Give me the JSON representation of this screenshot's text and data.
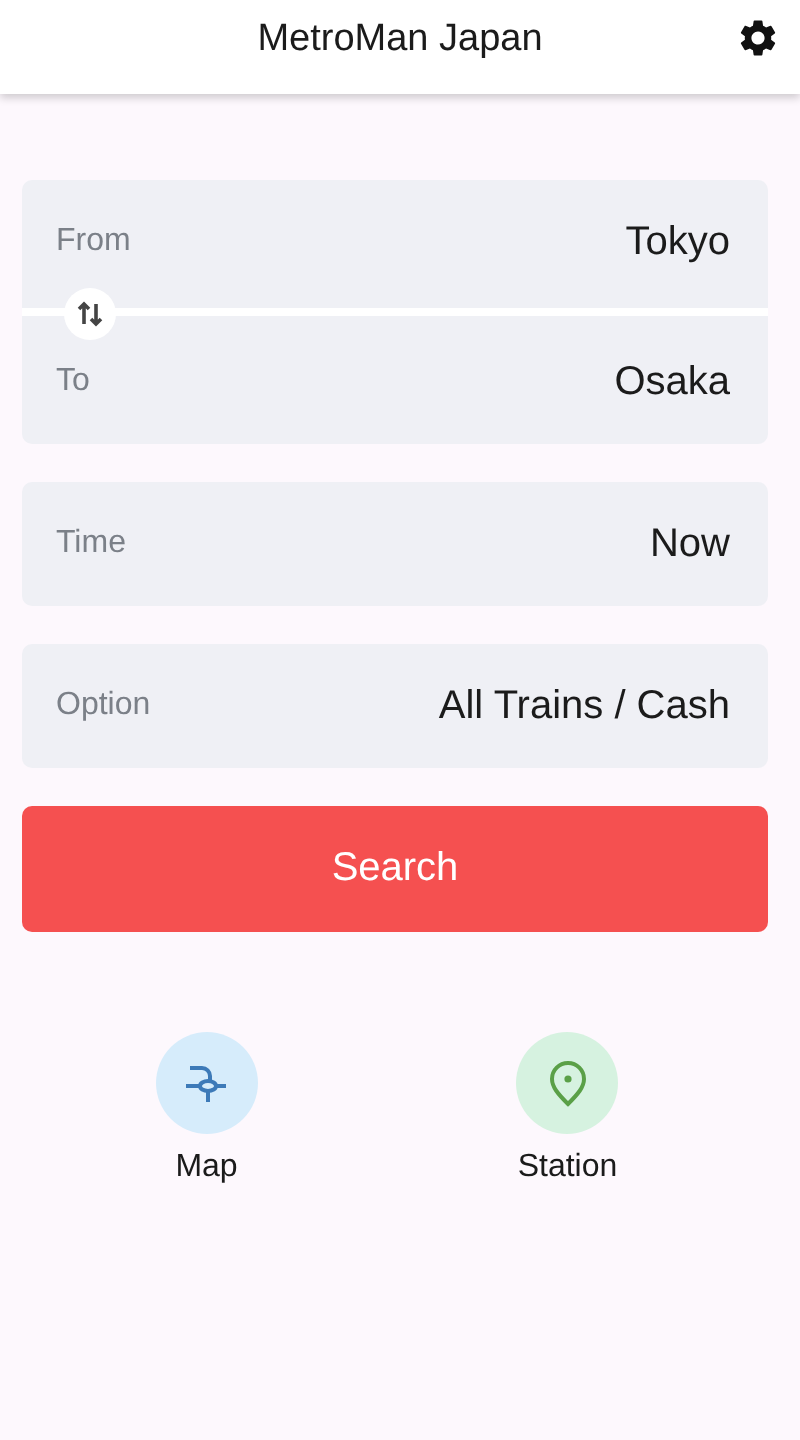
{
  "app_bar": {
    "title": "MetroMan Japan"
  },
  "route": [
    {
      "label": "From",
      "value": "Tokyo"
    },
    {
      "label": "To",
      "value": "Osaka"
    }
  ],
  "settings": [
    {
      "label": "Time",
      "value": "Now"
    },
    {
      "label": "Option",
      "value": "All Trains / Cash"
    }
  ],
  "search_button": "Search",
  "shortcuts": [
    {
      "kind": "map",
      "label": "Map",
      "color": "#d6ecfb"
    },
    {
      "kind": "station",
      "label": "Station",
      "color": "#d6f2e0"
    }
  ]
}
